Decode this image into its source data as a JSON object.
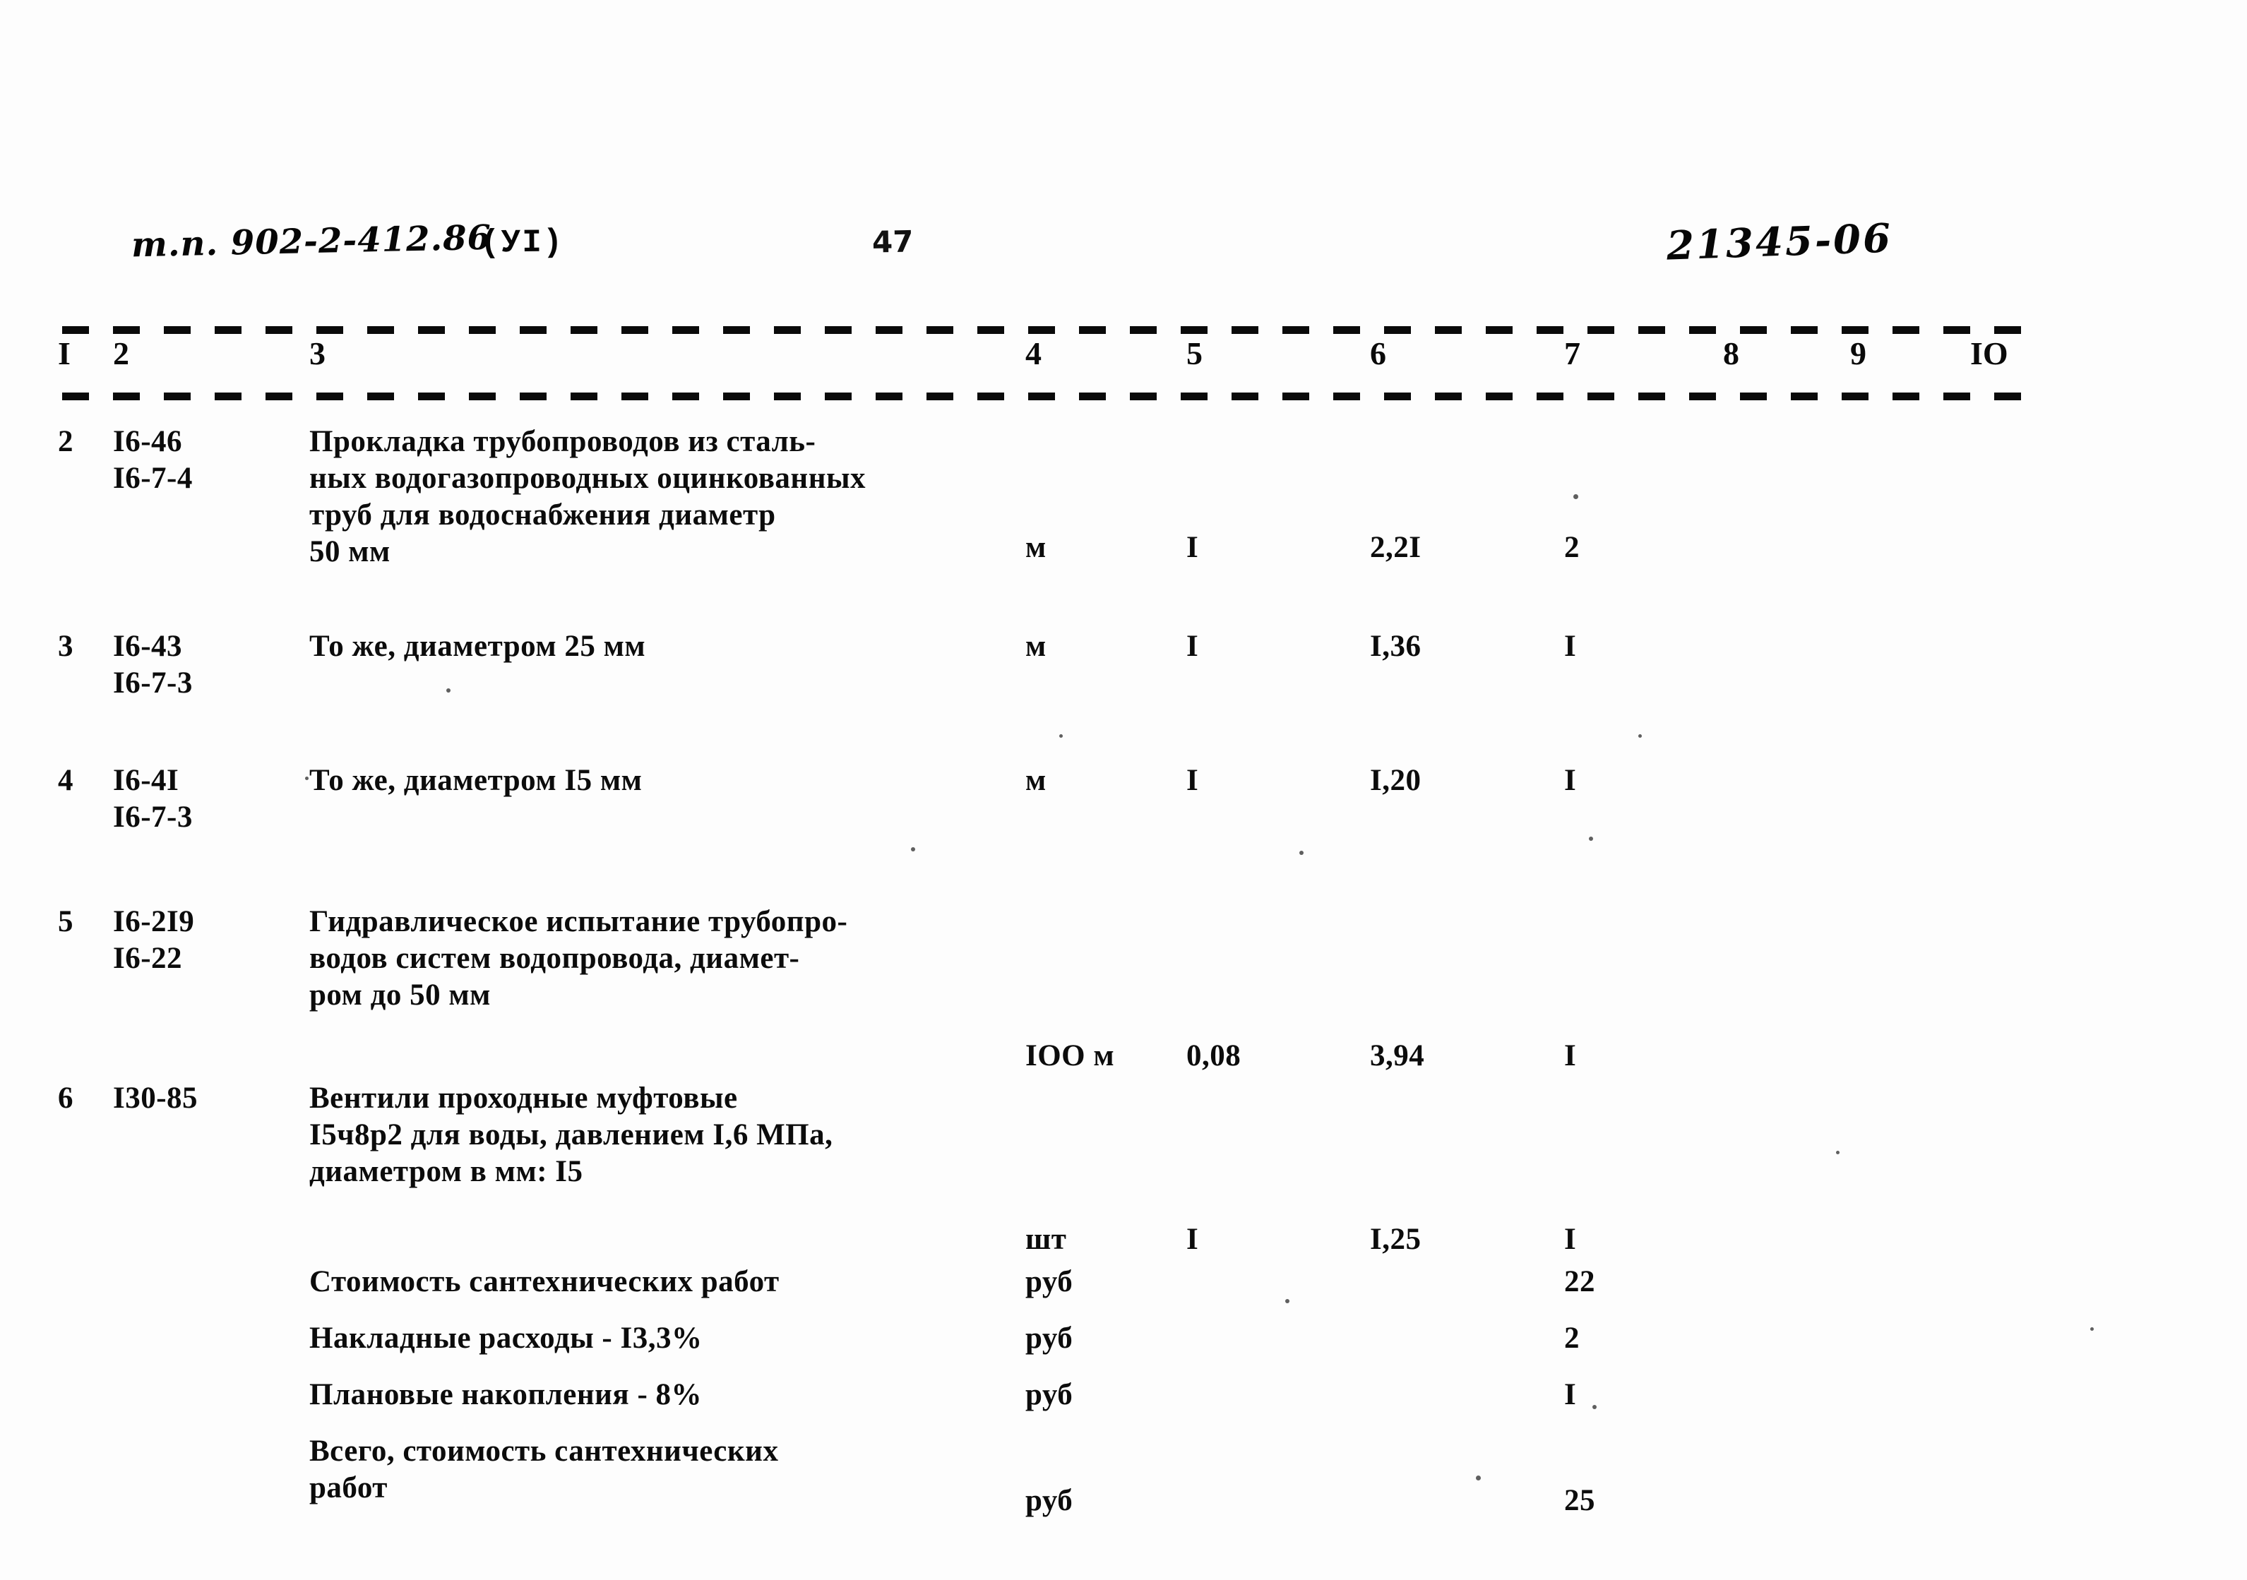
{
  "header": {
    "doc_code": "т.п. 902-2-412.86",
    "revision": "(УI)",
    "page_number": "47",
    "sheet_number": "21345-06"
  },
  "table": {
    "column_numbers": [
      "I",
      "2",
      "3",
      "4",
      "5",
      "6",
      "7",
      "8",
      "9",
      "IO"
    ],
    "rows": [
      {
        "num": "2",
        "code": "I6-46\nI6-7-4",
        "desc": "Прокладка  трубопроводов из сталь-\nных водогазопроводных оцинкованных\nтруб для водоснабжения диаметр\n50 мм",
        "unit": "м",
        "col5": "I",
        "col6": "2,2I",
        "col7": "2",
        "col8": "",
        "col9": "",
        "col10": ""
      },
      {
        "num": "3",
        "code": "I6-43\nI6-7-3",
        "desc": "То же, диаметром 25 мм",
        "unit": "м",
        "col5": "I",
        "col6": "I,36",
        "col7": "I",
        "col8": "",
        "col9": "",
        "col10": ""
      },
      {
        "num": "4",
        "code": "I6-4I\nI6-7-3",
        "desc": "То же, диаметром I5 мм",
        "unit": "м",
        "col5": "I",
        "col6": "I,20",
        "col7": "I",
        "col8": "",
        "col9": "",
        "col10": ""
      },
      {
        "num": "5",
        "code": "I6-2I9\nI6-22",
        "desc": "Гидравлическое испытание трубопро-\nводов систем водопровода, диамет-\nром до 50 мм",
        "unit": "IОО м",
        "col5": "0,08",
        "col6": "3,94",
        "col7": "I",
        "col8": "",
        "col9": "",
        "col10": ""
      },
      {
        "num": "6",
        "code": "I30-85",
        "desc": "Вентили проходные муфтовые\nI5ч8р2 для воды, давлением I,6 МПа,\nдиаметром в мм: I5",
        "unit": "шт",
        "col5": "I",
        "col6": "I,25",
        "col7": "I",
        "col8": "",
        "col9": "",
        "col10": ""
      }
    ],
    "summary_rows": [
      {
        "num": "",
        "code": "",
        "desc": "Стоимость сантехнических работ",
        "unit": "руб",
        "col5": "",
        "col6": "",
        "col7": "22",
        "col8": "",
        "col9": "",
        "col10": ""
      },
      {
        "num": "",
        "code": "",
        "desc": "Накладные расходы - I3,3%",
        "unit": "руб",
        "col5": "",
        "col6": "",
        "col7": "2",
        "col8": "",
        "col9": "",
        "col10": ""
      },
      {
        "num": "",
        "code": "",
        "desc": "Плановые накопления - 8%",
        "unit": "руб",
        "col5": "",
        "col6": "",
        "col7": "I",
        "col8": "",
        "col9": "",
        "col10": ""
      },
      {
        "num": "",
        "code": "",
        "desc": "Всего, стоимость сантехнических\nработ",
        "unit": "руб",
        "col5": "",
        "col6": "",
        "col7": "25",
        "col8": "",
        "col9": "",
        "col10": ""
      }
    ]
  },
  "layout": {
    "column_x": [
      82,
      160,
      438,
      1452,
      1680,
      1940,
      2215,
      2440,
      2620,
      2790
    ],
    "row_tops": [
      0,
      290,
      480,
      680,
      930,
      1190,
      1270,
      1350,
      1430
    ],
    "unit_offsets": [
      150,
      0,
      0,
      190,
      200,
      0,
      0,
      0,
      70
    ]
  }
}
